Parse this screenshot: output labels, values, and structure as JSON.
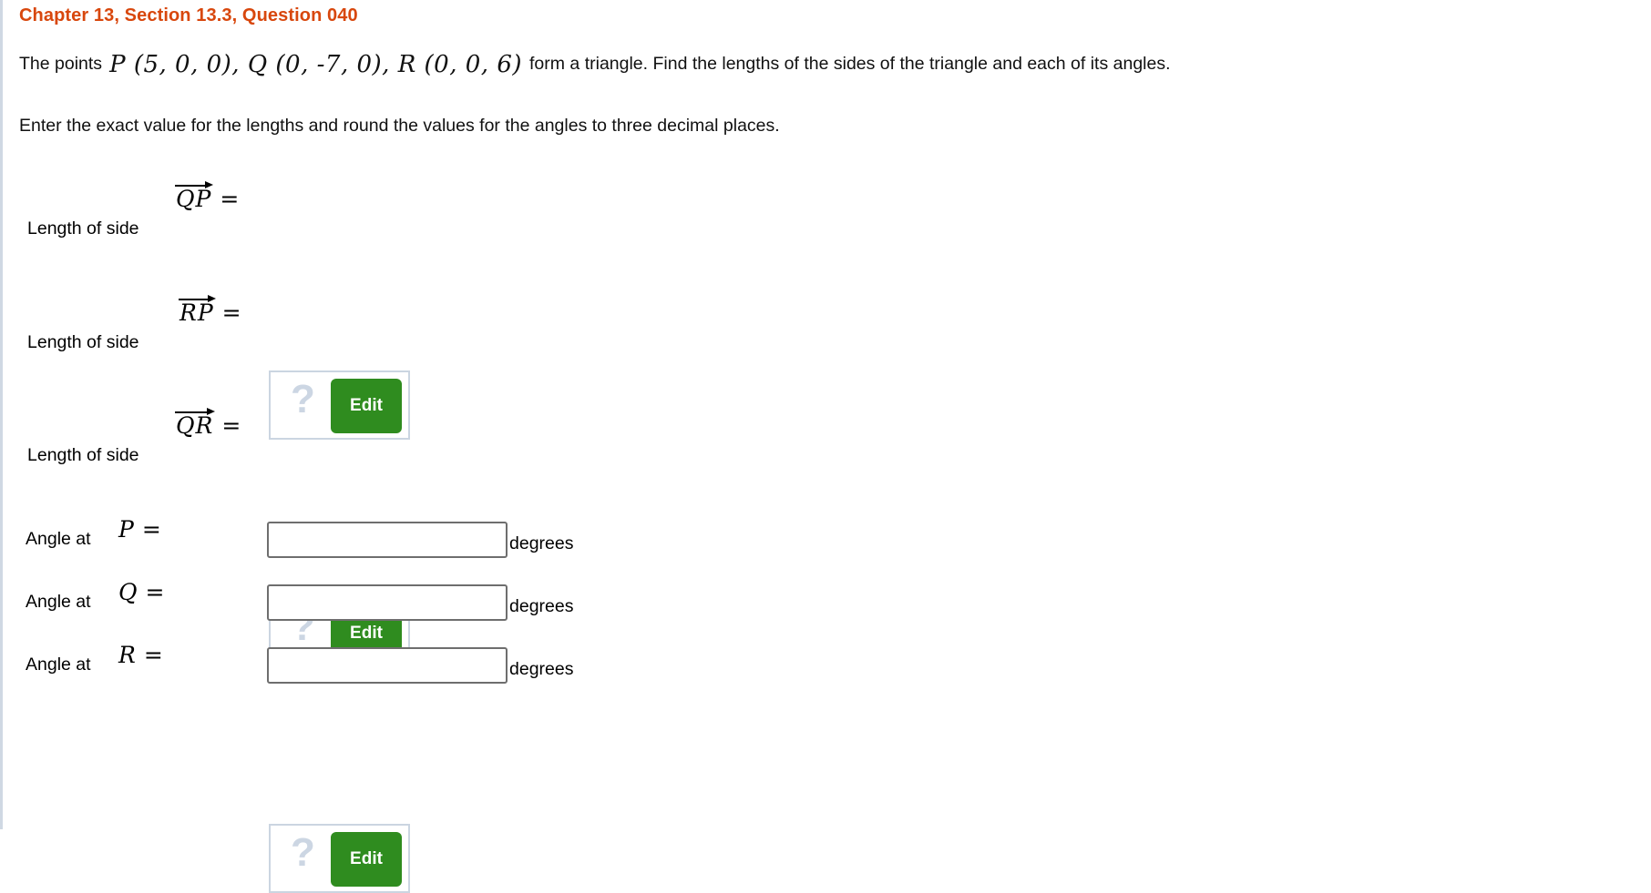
{
  "header": {
    "title": "Chapter 13, Section 13.3, Question 040",
    "color": "#d8470d"
  },
  "prompt": {
    "lead": "The points",
    "points_math": "P (5, 0, 0), Q (0, -7, 0), R (0, 0, 6)",
    "tail": "form a triangle. Find the lengths of the sides of the triangle and each of its angles.",
    "instruction": "Enter the exact value for the lengths and round the values for the angles to three decimal places."
  },
  "sides": [
    {
      "label": "Length of side",
      "vector": "QP",
      "equals": "=",
      "placeholder_glyph": "?",
      "edit_label": "Edit",
      "value": ""
    },
    {
      "label": "Length of side",
      "vector": "RP",
      "equals": "=",
      "placeholder_glyph": "?",
      "edit_label": "Edit",
      "value": ""
    },
    {
      "label": "Length of side",
      "vector": "QR",
      "equals": "=",
      "placeholder_glyph": "?",
      "edit_label": "Edit",
      "value": ""
    }
  ],
  "angles": [
    {
      "label": "Angle at",
      "vertex": "P",
      "equals": "=",
      "value": "",
      "placeholder": "",
      "unit": "degrees"
    },
    {
      "label": "Angle at",
      "vertex": "Q",
      "equals": "=",
      "value": "",
      "placeholder": "",
      "unit": "degrees"
    },
    {
      "label": "Angle at",
      "vertex": "R",
      "equals": "=",
      "value": "",
      "placeholder": "",
      "unit": "degrees"
    }
  ],
  "colors": {
    "header_orange": "#d8470d",
    "edit_green": "#2f8c1f",
    "mathbox_border": "#cbd5e1",
    "placeholder_grey": "#ccd6e3",
    "input_border": "#6e6e6e"
  }
}
